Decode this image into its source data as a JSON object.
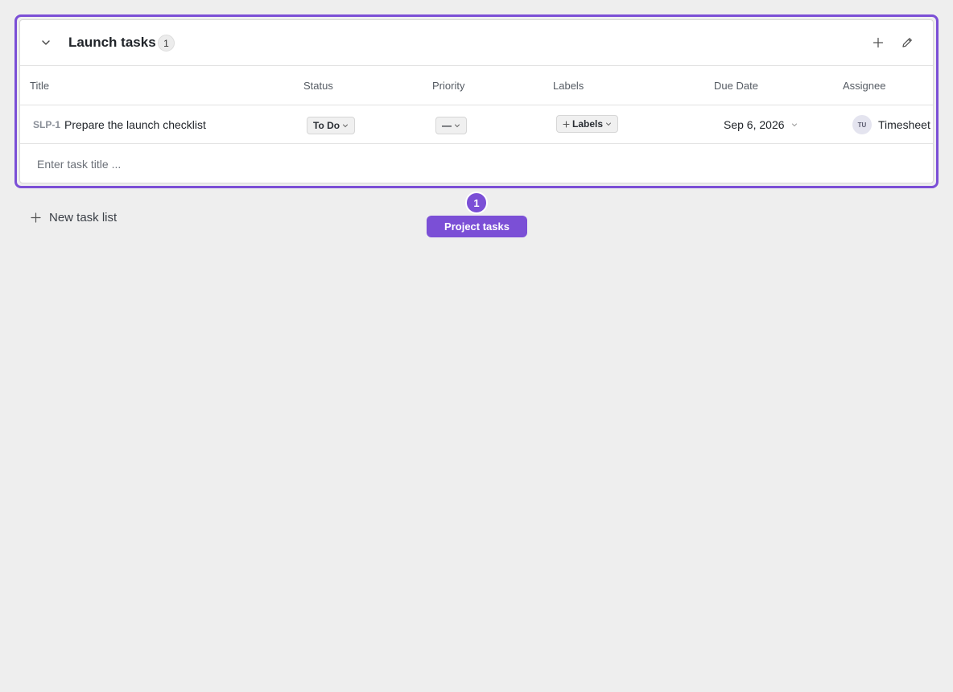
{
  "task_list": {
    "title": "Launch tasks",
    "count": "1",
    "columns": [
      "Title",
      "Status",
      "Priority",
      "Labels",
      "Due Date",
      "Assignee"
    ],
    "tasks": [
      {
        "key": "SLP-1",
        "title": "Prepare the launch checklist",
        "status": "To Do",
        "priority": "—",
        "labels_label": "Labels",
        "due_date": "Sep 6, 2026",
        "assignee_initials": "TU",
        "assignee_name": "Timesheet"
      }
    ],
    "new_task_placeholder": "Enter task title ..."
  },
  "new_list_label": "New task list",
  "tour": {
    "step": "1",
    "label": "Project tasks"
  },
  "colors": {
    "accent": "#7b4fd6",
    "background": "#eeeeee"
  }
}
